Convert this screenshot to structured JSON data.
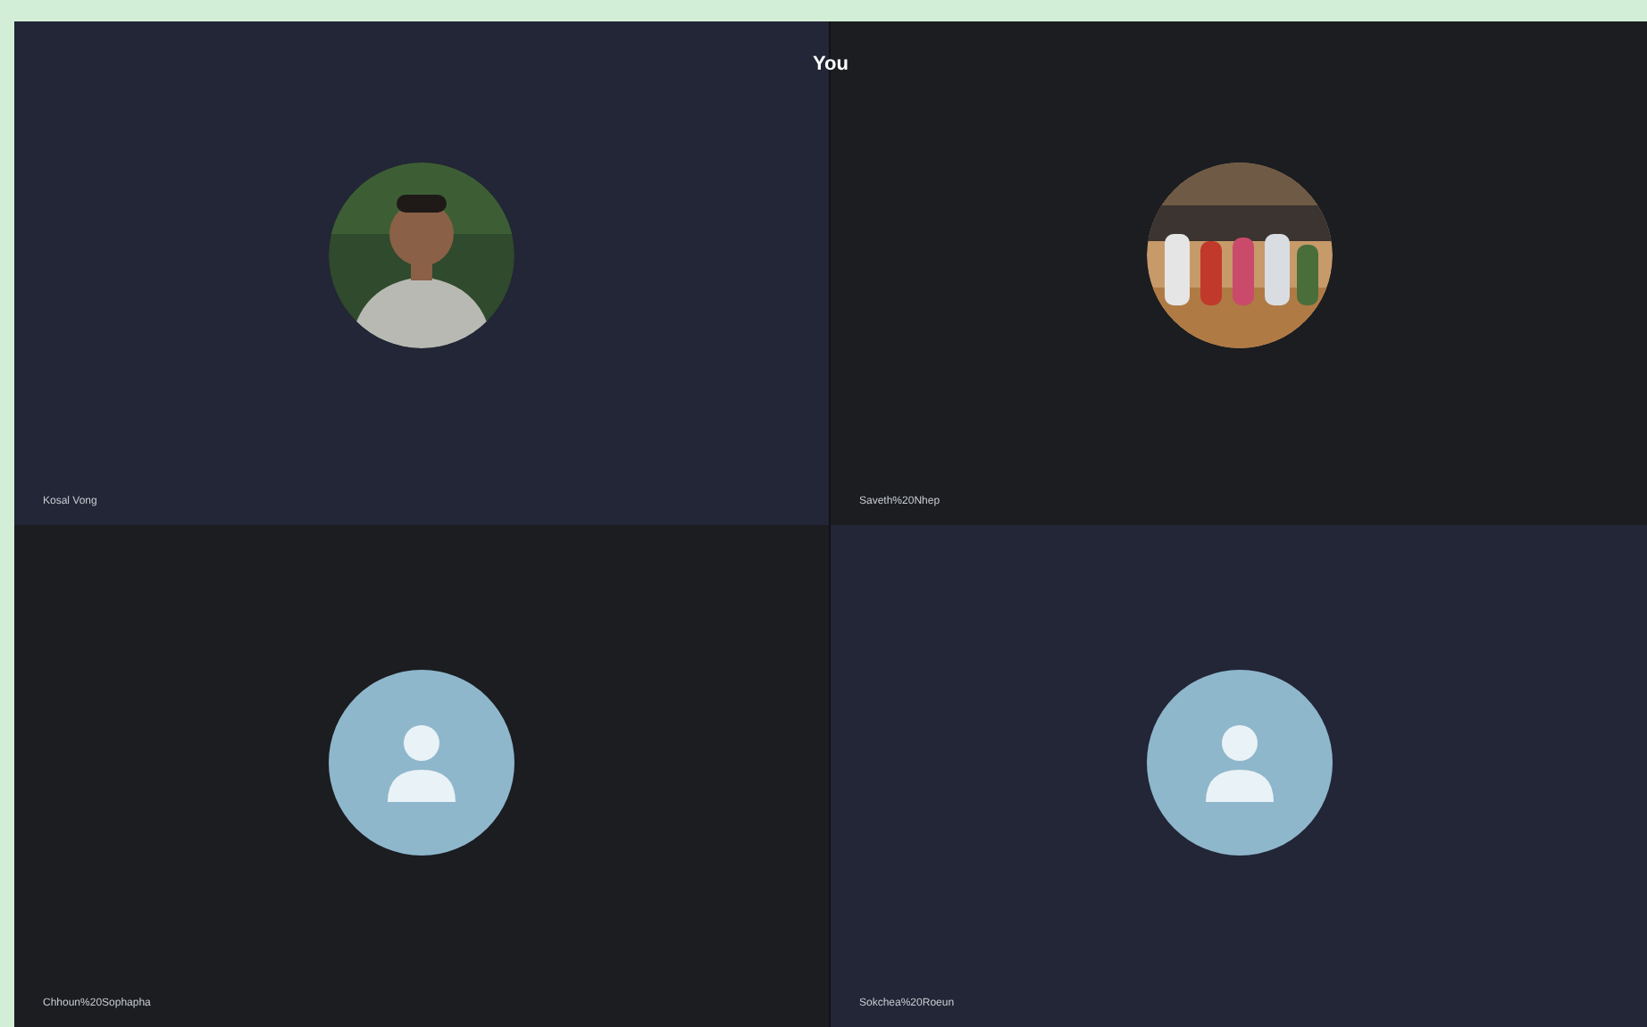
{
  "header": {
    "title": "You"
  },
  "participants": [
    {
      "name": "Kosal Vong"
    },
    {
      "name": "Saveth%20Nhep"
    },
    {
      "name": "Chhoun%20Sophapha",
      "avatar": {
        "kind": "placeholder"
      }
    },
    {
      "name": "Sokchea%20Roeun",
      "avatar": {
        "kind": "placeholder"
      }
    }
  ]
}
